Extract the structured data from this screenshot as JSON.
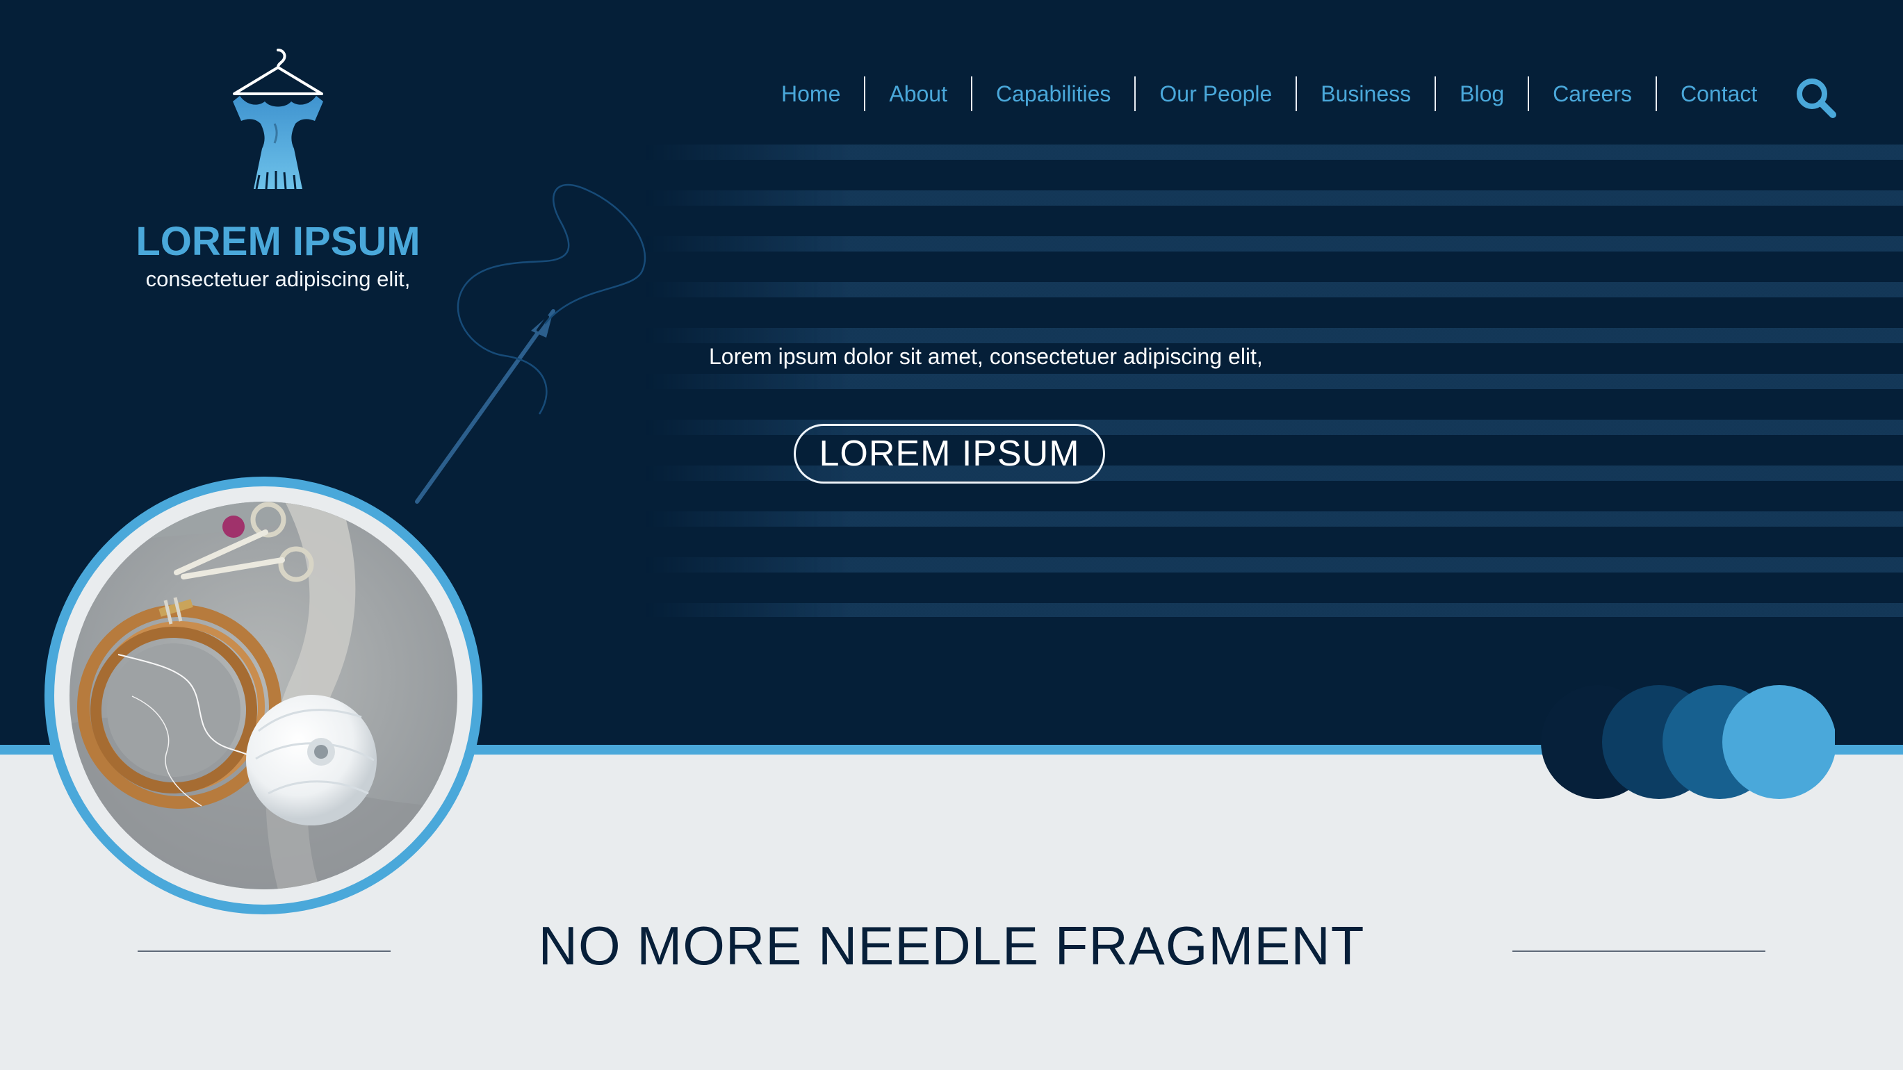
{
  "brand": {
    "title": "LOREM IPSUM",
    "subtitle": "consectetuer adipiscing elit,",
    "icon": "dress-on-hanger-icon"
  },
  "nav": {
    "items": [
      {
        "label": "Home"
      },
      {
        "label": "About"
      },
      {
        "label": "Capabilities"
      },
      {
        "label": "Our People"
      },
      {
        "label": "Business"
      },
      {
        "label": "Blog"
      },
      {
        "label": "Careers"
      },
      {
        "label": "Contact"
      }
    ],
    "search_icon": "search-icon"
  },
  "hero": {
    "text": "Lorem ipsum dolor sit amet, consectetuer adipiscing elit,",
    "button_label": "LOREM IPSUM"
  },
  "section": {
    "title": "NO MORE NEEDLE FRAGMENT"
  },
  "colors": {
    "hero_background": "#051f38",
    "accent_blue": "#4aa8da",
    "mid_blue": "#17608f",
    "deep_blue": "#0c3d63",
    "light_background": "#e9ecee",
    "title_text": "#071f39"
  }
}
